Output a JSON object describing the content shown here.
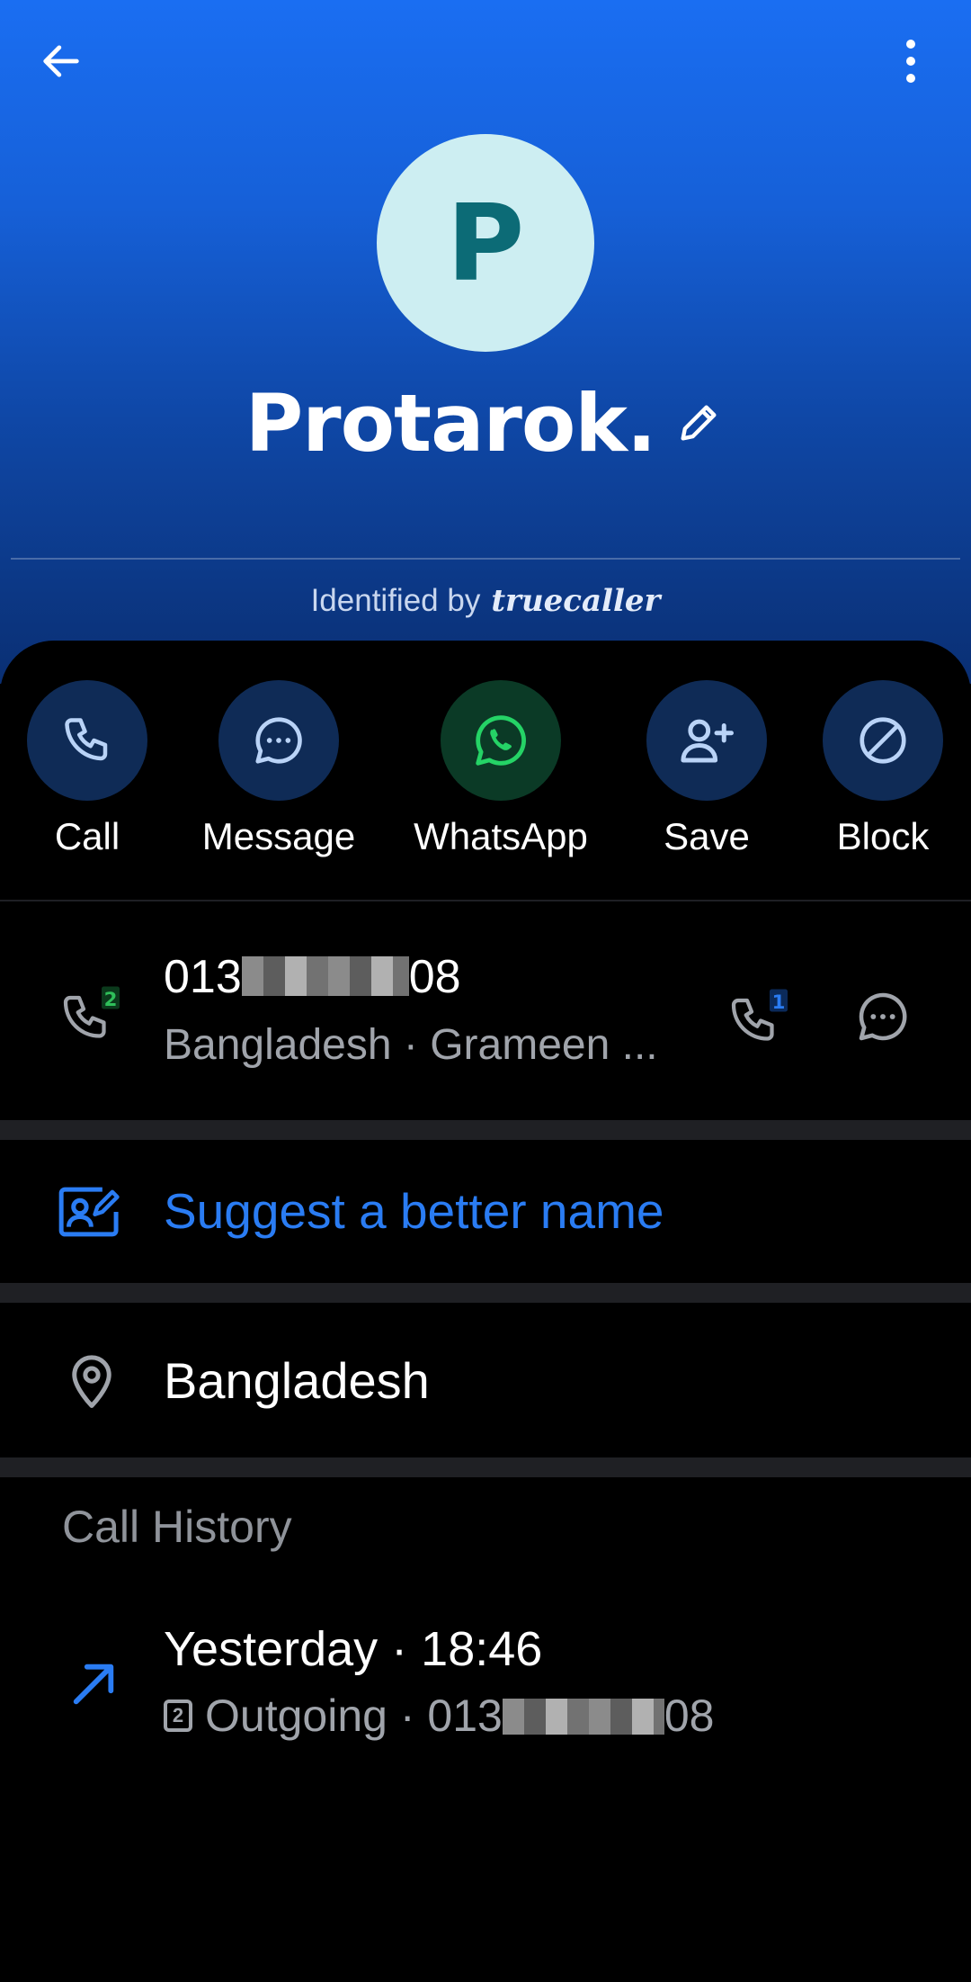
{
  "contact": {
    "initial": "P",
    "name": "Protarok.",
    "identified_by": "Identified by",
    "brand": "truecaller"
  },
  "actions": [
    {
      "label": "Call",
      "icon": "phone-icon"
    },
    {
      "label": "Message",
      "icon": "chat-bubble-icon"
    },
    {
      "label": "WhatsApp",
      "icon": "whatsapp-icon"
    },
    {
      "label": "Save",
      "icon": "add-person-icon"
    },
    {
      "label": "Block",
      "icon": "block-icon"
    }
  ],
  "phone": {
    "number_prefix": "013",
    "number_suffix": "08",
    "details": "Bangladesh · Grameen ...",
    "sim_left": "2",
    "sim_right": "1"
  },
  "suggest": {
    "label": "Suggest a better name"
  },
  "location": {
    "label": "Bangladesh"
  },
  "history": {
    "title": "Call History",
    "items": [
      {
        "time": "Yesterday · 18:46",
        "sim": "2",
        "type": "Outgoing",
        "separator": "·",
        "number_prefix": "013",
        "number_suffix": "08"
      }
    ]
  },
  "colors": {
    "accent": "#2a7cf3",
    "whatsapp": "#25d366",
    "sim_green": "#2fbf5a"
  }
}
